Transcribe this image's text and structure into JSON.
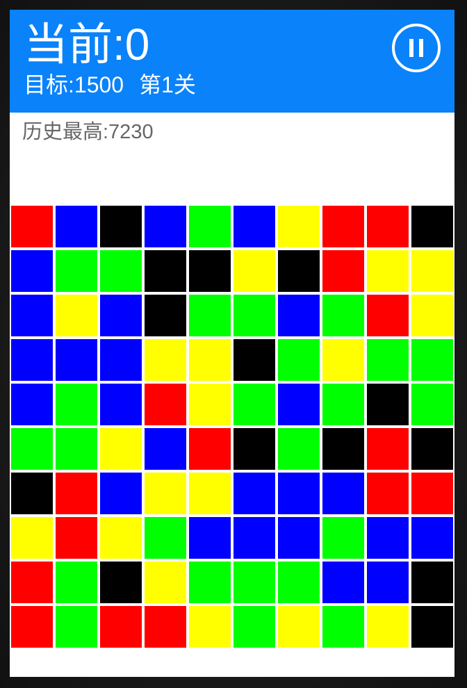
{
  "header": {
    "current_label": "当前:0",
    "target_label": "目标:1500",
    "level_label": "第1关",
    "pause_icon": "pause-icon"
  },
  "best_label": "历史最高:7230",
  "colors": {
    "R": "#ff0000",
    "B": "#0000ff",
    "K": "#000000",
    "G": "#00ff00",
    "Y": "#ffff00",
    "header_bg": "#0a82fa"
  },
  "board": [
    [
      "R",
      "B",
      "K",
      "B",
      "G",
      "B",
      "Y",
      "R",
      "R",
      "K"
    ],
    [
      "B",
      "G",
      "G",
      "K",
      "K",
      "Y",
      "K",
      "R",
      "Y",
      "Y"
    ],
    [
      "B",
      "Y",
      "B",
      "K",
      "G",
      "G",
      "B",
      "G",
      "R",
      "Y"
    ],
    [
      "B",
      "B",
      "B",
      "Y",
      "Y",
      "K",
      "G",
      "Y",
      "G",
      "G"
    ],
    [
      "B",
      "G",
      "B",
      "R",
      "Y",
      "G",
      "B",
      "G",
      "K",
      "G"
    ],
    [
      "G",
      "G",
      "Y",
      "B",
      "R",
      "K",
      "G",
      "K",
      "R",
      "K"
    ],
    [
      "K",
      "R",
      "B",
      "Y",
      "Y",
      "B",
      "B",
      "B",
      "R",
      "R"
    ],
    [
      "Y",
      "R",
      "Y",
      "G",
      "B",
      "B",
      "B",
      "G",
      "B",
      "B"
    ],
    [
      "R",
      "G",
      "K",
      "Y",
      "G",
      "G",
      "G",
      "B",
      "B",
      "K"
    ],
    [
      "R",
      "G",
      "R",
      "R",
      "Y",
      "G",
      "Y",
      "G",
      "Y",
      "K"
    ]
  ]
}
